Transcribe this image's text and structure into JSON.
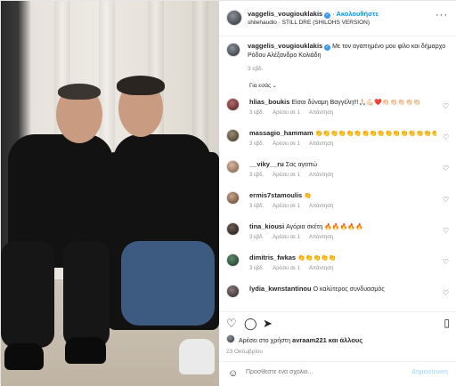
{
  "post": {
    "author": "vaggelis_vougiouklakis",
    "follow_label": "Ακολουθήστε",
    "subtitle": "shilehaudio · STILL DRE (SHILOHS VERSION)",
    "caption_author": "vaggelis_vougiouklakis",
    "caption_text": "Με τον αγαπημένο μου φίλο και δήμαρχο Ρόδου Αλέξανδρο Κολιάδη",
    "caption_time": "3 εβδ.",
    "sort_label": "Για εσάς",
    "more_icon": "more-icon"
  },
  "comments": [
    {
      "user": "hlias_boukis",
      "text": "Είσαι δύναμη Βαγγέλη!!!🙏🏻💪🏻❤️👏🏻👏🏻👏🏻👏🏻👏🏻",
      "time": "3 εβδ.",
      "likes": "Αρέσει σε 1",
      "reply": "Απάντηση"
    },
    {
      "user": "massagio_hammam",
      "text": "👏👏👏👏👏👏👏👏👏👏👏👏👏👏👏👏👏👏👏👏",
      "time": "3 εβδ.",
      "likes": "Αρέσει σε 1",
      "reply": "Απάντηση"
    },
    {
      "user": "__viky__ru",
      "text": "Σας αγαπώ",
      "time": "3 εβδ.",
      "likes": "Αρέσει σε 1",
      "reply": "Απάντηση"
    },
    {
      "user": "ermis7stamoulis",
      "text": "👏",
      "time": "3 εβδ.",
      "likes": "Αρέσει σε 1",
      "reply": "Απάντηση"
    },
    {
      "user": "tina_kiousi",
      "text": "Αγόρια σκέτη 🔥🔥🔥🔥🔥",
      "time": "3 εβδ.",
      "likes": "Αρέσει σε 1",
      "reply": "Απάντηση"
    },
    {
      "user": "dimitris_fwkas",
      "text": "👏👏👏👏👏",
      "time": "3 εβδ.",
      "likes": "Αρέσει σε 1",
      "reply": "Απάντηση"
    },
    {
      "user": "lydia_kwnstantinou",
      "text": "Ο καλύτερος συνδυασμός",
      "time": "",
      "likes": "",
      "reply": ""
    }
  ],
  "actions": {
    "likes_prefix": "Αρέσει στο χρήστη",
    "likes_user": "avraam221",
    "likes_suffix": "και άλλους",
    "date": "23 Οκτωβρίου"
  },
  "composer": {
    "placeholder": "Προσθέστε ένα σχόλιο...",
    "post_label": "Δημοσίευση"
  },
  "colors": {
    "accent": "#0095f6",
    "verified": "#3897f0"
  }
}
